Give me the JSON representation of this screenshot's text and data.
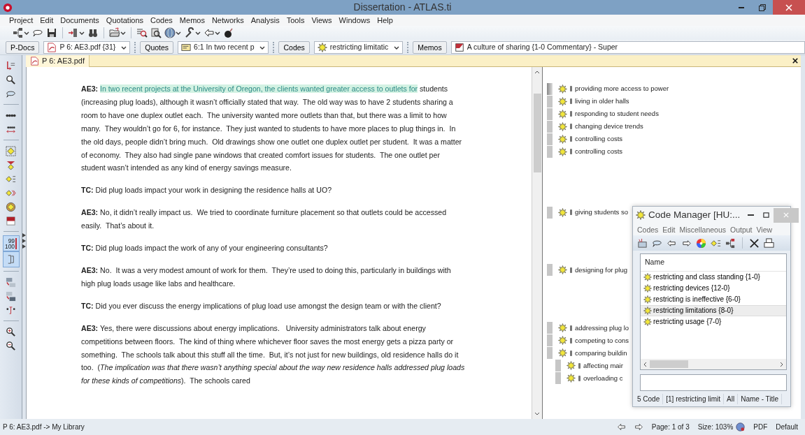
{
  "window": {
    "title": "Dissertation - ATLAS.ti"
  },
  "menu": [
    "Project",
    "Edit",
    "Documents",
    "Quotations",
    "Codes",
    "Memos",
    "Networks",
    "Analysis",
    "Tools",
    "Views",
    "Windows",
    "Help"
  ],
  "selectors": [
    {
      "kind": "document",
      "button": "P-Docs",
      "value": "P 6: AE3.pdf {31}",
      "dropdown": true
    },
    {
      "kind": "quotation",
      "button": "Quotes",
      "value": "6:1 In two recent p",
      "dropdown": true
    },
    {
      "kind": "code",
      "button": "Codes",
      "value": "restricting limitatic",
      "dropdown": true
    },
    {
      "kind": "memo",
      "button": "Memos",
      "value": "A culture of sharing {1-0 Commentary} - Super",
      "dropdown": false
    }
  ],
  "left_toolbar": [
    {
      "kind": "tool",
      "on": false
    },
    {
      "kind": "tool",
      "on": false
    },
    {
      "kind": "tool",
      "on": false
    },
    {
      "kind": "separator"
    },
    {
      "kind": "tool",
      "on": false
    },
    {
      "kind": "tool",
      "on": false
    },
    {
      "kind": "separator"
    },
    {
      "kind": "tool",
      "on": false
    },
    {
      "kind": "tool",
      "on": false
    },
    {
      "kind": "tool",
      "on": false
    },
    {
      "kind": "tool",
      "on": false
    },
    {
      "kind": "tool",
      "on": false
    },
    {
      "kind": "tool",
      "on": false
    },
    {
      "kind": "separator"
    },
    {
      "kind": "tool",
      "on": true,
      "text": [
        "99",
        "100"
      ]
    },
    {
      "kind": "tool",
      "on": true
    },
    {
      "kind": "separator"
    },
    {
      "kind": "tool",
      "on": false
    },
    {
      "kind": "tool",
      "on": false
    },
    {
      "kind": "tool",
      "on": false
    },
    {
      "kind": "separator"
    },
    {
      "kind": "tool",
      "on": false
    },
    {
      "kind": "tool",
      "on": false
    }
  ],
  "document": {
    "tab": "P 6: AE3.pdf",
    "paragraphs": [
      {
        "speaker": "AE3:",
        "segments": [
          {
            "text": "In two recent projects at the University of Oregon, the clients wanted greater access to outlets for",
            "highlighted": true
          },
          {
            "text": " students (increasing plug loads), although it wasn’t officially stated that way.  The old way was to have 2 students sharing a room to have one duplex outlet each.  The university wanted more outlets than that, but there was a limit to how many.  They wouldn’t go for 6, for instance.  They just wanted to students to have more places to plug things in.  In the old days, people didn’t bring much.  Old drawings show one outlet one duplex outlet per student.  It was a matter of economy.  They also had single pane windows that created comfort issues for students.  The one outlet per student wasn’t intended as any kind of energy savings measure.",
            "highlighted": false
          }
        ],
        "codes": [
          {
            "label": "providing more access to power"
          },
          {
            "label": "living in older halls"
          },
          {
            "label": "responding to student needs"
          },
          {
            "label": "changing device trends"
          },
          {
            "label": "controlling costs"
          },
          {
            "label": "controlling costs"
          }
        ]
      },
      {
        "speaker": "TC:",
        "segments": [
          {
            "text": "Did plug loads impact your work in designing the residence halls at UO?",
            "highlighted": false
          }
        ]
      },
      {
        "speaker": "AE3:",
        "segments": [
          {
            "text": "No, it didn’t really impact us.  We tried to coordinate furniture placement so that outlets could be accessed easily.  That’s about it.",
            "highlighted": false
          }
        ],
        "codes": [
          {
            "label": "giving students so"
          }
        ]
      },
      {
        "speaker": "TC:",
        "segments": [
          {
            "text": "Did plug loads impact the work of any of your engineering consultants?",
            "highlighted": false
          }
        ]
      },
      {
        "speaker": "AE3:",
        "segments": [
          {
            "text": "No.  It was a very modest amount of work for them.  They’re used to doing this, particularly in buildings with high plug loads usage like labs and healthcare.",
            "highlighted": false
          }
        ],
        "codes": [
          {
            "label": "designing for plug"
          }
        ]
      },
      {
        "speaker": "TC:",
        "segments": [
          {
            "text": "Did you ever discuss the energy implications of plug load use amongst the design team or with the client?",
            "highlighted": false
          }
        ]
      },
      {
        "speaker": "AE3:",
        "segments": [
          {
            "text": "Yes, there were discussions about energy implications.   University administrators talk about energy competitions between floors.  The kind of thing where whichever floor saves the most energy gets a pizza party or something.  The schools talk about this stuff all the time.  But, it’s not just for new buildings, old residence halls do it too.  (*The implication was that there wasn’t anything special about the way new residence halls addressed plug loads for these kinds of competitions*).  The schools cared",
            "highlighted": false
          }
        ],
        "codes": [
          {
            "label": "addressing plug lo"
          },
          {
            "label": "competing to cons"
          },
          {
            "label": "comparing buildin",
            "children": [
              {
                "label": "affecting mair"
              },
              {
                "label": "overloading c"
              }
            ]
          }
        ]
      }
    ]
  },
  "code_manager": {
    "title": "Code Manager [HU:...",
    "menu": [
      "Codes",
      "Edit",
      "Miscellaneous",
      "Output",
      "View"
    ],
    "column": "Name",
    "codes": [
      {
        "label": "restricting and class standing {1-0}",
        "selected": false
      },
      {
        "label": "restricting devices {12-0}",
        "selected": false
      },
      {
        "label": "restricting is ineffective {6-0}",
        "selected": false
      },
      {
        "label": "restricting limitations {8-0}",
        "selected": true
      },
      {
        "label": "restricting usage {7-0}",
        "selected": false
      }
    ],
    "status": [
      "5 Code",
      "[1] restricting limit",
      "All",
      "Name - Title"
    ]
  },
  "status_bar": {
    "path": "P 6: AE3.pdf -> My Library",
    "page": "Page: 1 of 3",
    "size": "Size: 103%",
    "format": "PDF",
    "mode": "Default"
  }
}
